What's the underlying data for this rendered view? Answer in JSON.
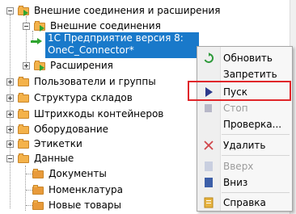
{
  "tree": {
    "items": [
      {
        "label": "Внешние соединения и расширения"
      },
      {
        "label": "Внешние соединения"
      },
      {
        "label_line1": "1С Предприятие версия 8:",
        "label_line2": "OneC_Connector*"
      },
      {
        "label": "Расширения"
      },
      {
        "label": "Пользователи и группы"
      },
      {
        "label": "Структура складов"
      },
      {
        "label": "Штрихкоды контейнеров"
      },
      {
        "label": "Оборудование"
      },
      {
        "label": "Этикетки"
      },
      {
        "label": "Данные"
      },
      {
        "label": "Документы"
      },
      {
        "label": "Номенклатура"
      },
      {
        "label": "Новые товары"
      }
    ]
  },
  "context_menu": {
    "items": [
      {
        "label": "Обновить",
        "icon": "refresh-icon",
        "enabled": true
      },
      {
        "label": "Запретить",
        "icon": "",
        "enabled": true
      },
      {
        "label": "Пуск",
        "icon": "play-icon",
        "enabled": true
      },
      {
        "label": "Стоп",
        "icon": "stop-icon",
        "enabled": false
      },
      {
        "label": "Проверка...",
        "icon": "",
        "enabled": true
      },
      {
        "label": "Удалить",
        "icon": "delete-icon",
        "enabled": true
      },
      {
        "label": "Вверх",
        "icon": "up-icon",
        "enabled": false
      },
      {
        "label": "Вниз",
        "icon": "down-icon",
        "enabled": true
      },
      {
        "label": "Справка",
        "icon": "help-icon",
        "enabled": true
      }
    ]
  },
  "colors": {
    "selection": "#1979ca",
    "highlight_border": "#e0262a",
    "folder": "#f4b24a",
    "connector_arrow": "#2fa52f"
  }
}
